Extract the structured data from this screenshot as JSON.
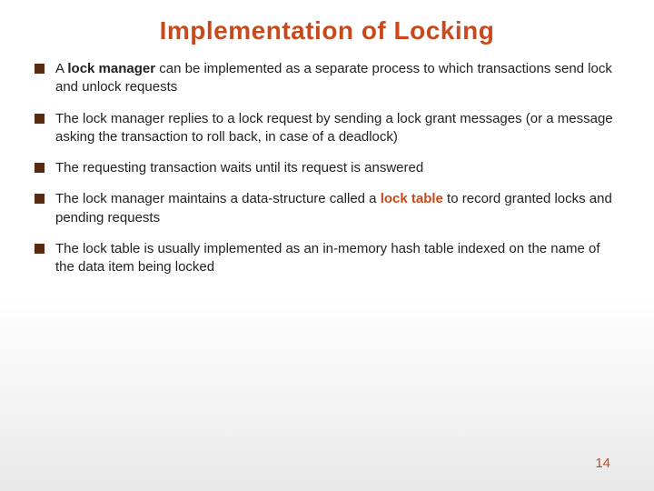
{
  "title": "Implementation of Locking",
  "bullets": [
    {
      "pre": "A ",
      "bold1": "lock manager",
      "post1": " can be implemented as a separate process to which transactions send lock and unlock requests"
    },
    {
      "pre": "The lock manager replies to a lock request by sending a lock grant messages (or a message asking the transaction to roll back, in case of a deadlock)"
    },
    {
      "pre": "The requesting transaction waits until its request is answered"
    },
    {
      "pre": "The lock manager maintains a data-structure called a ",
      "accent": "lock table",
      "post1": " to record granted locks and pending requests"
    },
    {
      "pre": "The lock table is usually implemented as an in-memory hash table indexed on the name of the data item being locked"
    }
  ],
  "pageNumber": "14"
}
